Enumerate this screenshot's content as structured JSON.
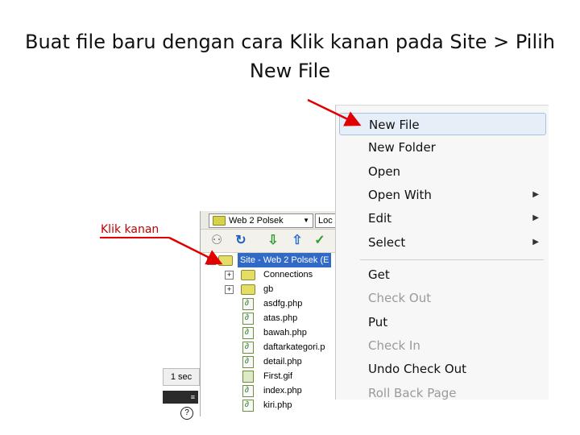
{
  "slide": {
    "title": "Buat file baru dengan cara Klik kanan pada Site > Pilih New File",
    "annotation_label": "Klik kanan",
    "colors": {
      "annotation": "#c00000",
      "arrow": "#e00000",
      "selection": "#3169c6"
    }
  },
  "files_panel": {
    "site_select": "Web 2 Polsek",
    "view_select": "Loc",
    "toolbar_icons": [
      "connect-icon",
      "refresh-icon",
      "get-down-arrow-icon",
      "put-up-arrow-icon",
      "check-out-icon"
    ],
    "tree": [
      {
        "label": "Site - Web 2 Polsek (E",
        "type": "site",
        "expander": "−"
      },
      {
        "label": "Connections",
        "type": "folder",
        "expander": "+"
      },
      {
        "label": "gb",
        "type": "folder",
        "expander": "+"
      },
      {
        "label": "asdfg.php",
        "type": "php"
      },
      {
        "label": "atas.php",
        "type": "php"
      },
      {
        "label": "bawah.php",
        "type": "php"
      },
      {
        "label": "daftarkategori.p",
        "type": "php"
      },
      {
        "label": "detail.php",
        "type": "php"
      },
      {
        "label": "First.gif",
        "type": "gif"
      },
      {
        "label": "index.php",
        "type": "php"
      },
      {
        "label": "kiri.php",
        "type": "php"
      }
    ]
  },
  "left_stub": {
    "time_label": "1 sec",
    "menu_glyph": "≡",
    "help_glyph": "?"
  },
  "context_menu": {
    "items": [
      {
        "label": "New File",
        "state": "hover"
      },
      {
        "label": "New Folder",
        "state": "enabled"
      },
      {
        "label": "Open",
        "state": "enabled"
      },
      {
        "label": "Open With",
        "state": "enabled",
        "submenu": true
      },
      {
        "label": "Edit",
        "state": "enabled",
        "submenu": true
      },
      {
        "label": "Select",
        "state": "enabled",
        "submenu": true
      },
      {
        "label": "Get",
        "state": "enabled"
      },
      {
        "label": "Check Out",
        "state": "disabled"
      },
      {
        "label": "Put",
        "state": "enabled"
      },
      {
        "label": "Check In",
        "state": "disabled"
      },
      {
        "label": "Undo Check Out",
        "state": "enabled"
      },
      {
        "label": "Roll Back Page",
        "state": "disabled"
      }
    ]
  }
}
